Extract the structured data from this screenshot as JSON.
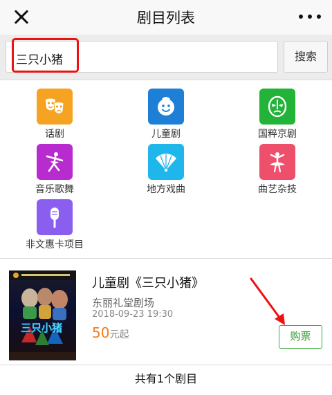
{
  "header": {
    "title": "剧目列表",
    "close_icon": "close-icon",
    "more_icon": "more-dots-icon"
  },
  "search": {
    "value": "三只小猪",
    "button_label": "搜索"
  },
  "categories": [
    {
      "label": "话剧",
      "icon": "theater-masks-icon",
      "color": "#f6a323"
    },
    {
      "label": "儿童剧",
      "icon": "smiley-face-icon",
      "color": "#1d7fd6"
    },
    {
      "label": "国粹京剧",
      "icon": "opera-mask-icon",
      "color": "#22b338"
    },
    {
      "label": "音乐歌舞",
      "icon": "dancer-icon",
      "color": "#b82bce"
    },
    {
      "label": "地方戏曲",
      "icon": "folding-fan-icon",
      "color": "#1fb6eb"
    },
    {
      "label": "曲艺杂技",
      "icon": "ballerina-icon",
      "color": "#ee4f6b"
    },
    {
      "label": "非文惠卡项目",
      "icon": "microphone-icon",
      "color": "#8a5ff0"
    }
  ],
  "show": {
    "title": "儿童剧《三只小猪》",
    "venue": "东丽礼堂剧场",
    "time": "2018-09-23 19:30",
    "price": "50",
    "price_suffix": "元起",
    "buy_label": "购票",
    "poster_text": "三只小猪"
  },
  "footer": {
    "total_text": "共有1个剧目"
  },
  "colors": {
    "accent_green": "#2d9a2d",
    "price_orange": "#f07c1b",
    "annotation_red": "#e11111"
  }
}
